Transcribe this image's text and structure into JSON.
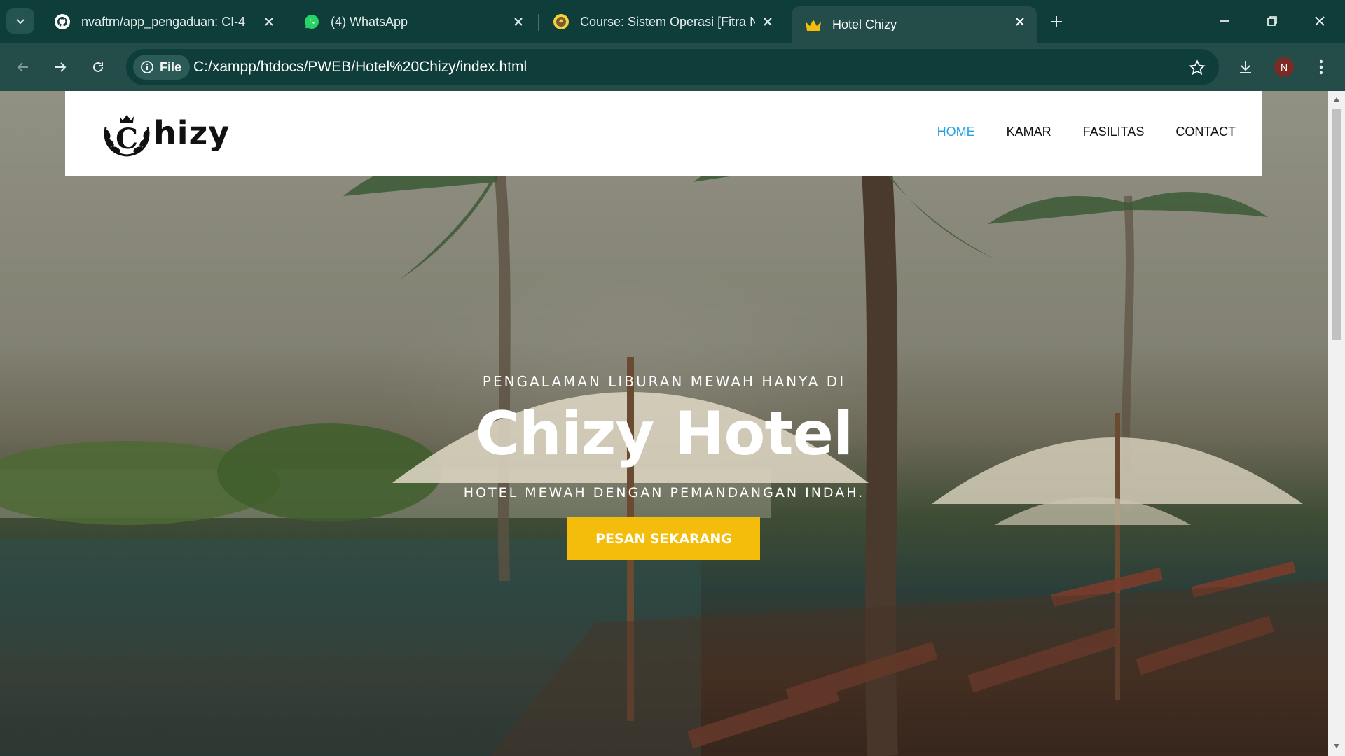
{
  "browser": {
    "tabs": [
      {
        "title": "nvaftrn/app_pengaduan: CI-4",
        "icon": "github-icon"
      },
      {
        "title": "(4) WhatsApp",
        "icon": "whatsapp-icon"
      },
      {
        "title": "Course: Sistem Operasi [Fitra N",
        "icon": "university-icon"
      },
      {
        "title": "Hotel Chizy",
        "icon": "crown-icon",
        "active": true
      }
    ],
    "site_chip": "File",
    "url": "C:/xampp/htdocs/PWEB/Hotel%20Chizy/index.html",
    "profile_initial": "N"
  },
  "site": {
    "logo_text": "hizy",
    "logo_letter": "C",
    "nav": [
      "HOME",
      "KAMAR",
      "FASILITAS",
      "CONTACT"
    ],
    "active_nav": "HOME"
  },
  "hero": {
    "kicker": "PENGALAMAN LIBURAN MEWAH HANYA DI",
    "title": "Chizy Hotel",
    "subtitle": "HOTEL MEWAH DENGAN PEMANDANGAN INDAH.",
    "cta": "PESAN SEKARANG"
  },
  "colors": {
    "chrome": "#0f3d3a",
    "toolbar": "#244d49",
    "nav_active": "#29a3e0",
    "cta": "#f4bc0b"
  }
}
